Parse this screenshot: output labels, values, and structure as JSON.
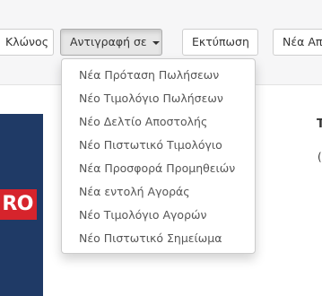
{
  "toolbar": {
    "clone_label": "Κλώνος",
    "copy_as_label": "Αντιγραφή σε",
    "print_label": "Εκτύπωση",
    "new_label": "Νέα Απ"
  },
  "dropdown": {
    "items": [
      "Νέα Πρόταση Πωλήσεων",
      "Νέο Τιμολόγιο Πωλήσεων",
      "Νέο Δελτίο Αποστολής",
      "Νέο Πιστωτικό Τιμολόγιο",
      "Νέα Προσφορά Προμηθειών",
      "Νέα εντολή Αγοράς",
      "Νέο Τιμολόγιο Αγορών",
      "Νέο Πιστωτικό Σημείωμα"
    ]
  },
  "logo": {
    "text": "RO"
  },
  "fragments": {
    "right_1": "T",
    "right_2": "("
  },
  "colors": {
    "toolbar_bg": "#f6f6f7",
    "logo_blue": "#1f3a66",
    "logo_red": "#d6242c"
  }
}
